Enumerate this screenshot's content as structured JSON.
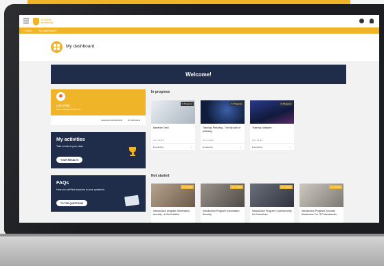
{
  "app": {
    "logo_text_line1": "G DATA",
    "logo_text_line2": "academy"
  },
  "breadcrumb": {
    "back_label": "< Back",
    "current": "My dashboard"
  },
  "header": {
    "title": "My dashboard"
  },
  "welcome": {
    "text": "Welcome!"
  },
  "profile": {
    "name": "Lisa Müller",
    "email": "lisa.mueller@example.com",
    "change_password": "CHANGE PASSWORD",
    "my_profile": "MY PROFILE"
  },
  "activities": {
    "title": "My activities",
    "subtitle": "Take a look at your stats",
    "button": "YOUR RESULTS"
  },
  "faqs": {
    "title": "FAQs",
    "subtitle": "Here you will find answers to your questions",
    "button": "TO THE QUESTIONS"
  },
  "in_progress": {
    "label": "In progress",
    "courses": [
      {
        "badge": "In Progress",
        "title": "Baseline Test I",
        "meta": "0/4  |  10 Min",
        "type": "E-Learning",
        "thumb": "#cfd6de"
      },
      {
        "badge": "In Progress",
        "title": "Training: Phishing - The flip side of phishing",
        "meta": "0/4  |  10 Min",
        "type": "E-Learning",
        "thumb": "#0f1c3a"
      },
      {
        "badge": "In Progress",
        "title": "Training: Malware",
        "meta": "0/4  |  10 Min",
        "type": "E-Learning",
        "thumb": "#1b2450"
      }
    ]
  },
  "not_started": {
    "label": "Not started",
    "courses": [
      {
        "badge": "Not started",
        "title": "Introduction program: Information security - in the frontline",
        "thumb": "#8a7a6a"
      },
      {
        "badge": "Not started",
        "title": "Introduction Program: Information Security",
        "thumb": "#6f6a66"
      },
      {
        "badge": "Not started",
        "title": "Introduction Program: Cybersecurity for Executives",
        "thumb": "#4a4f5c"
      },
      {
        "badge": "Not started",
        "title": "Introduction Program: Security Awareness For IT-Professionals",
        "thumb": "#9a9590"
      }
    ]
  },
  "colors": {
    "accent": "#f0b429",
    "navy": "#1f2d4a"
  }
}
